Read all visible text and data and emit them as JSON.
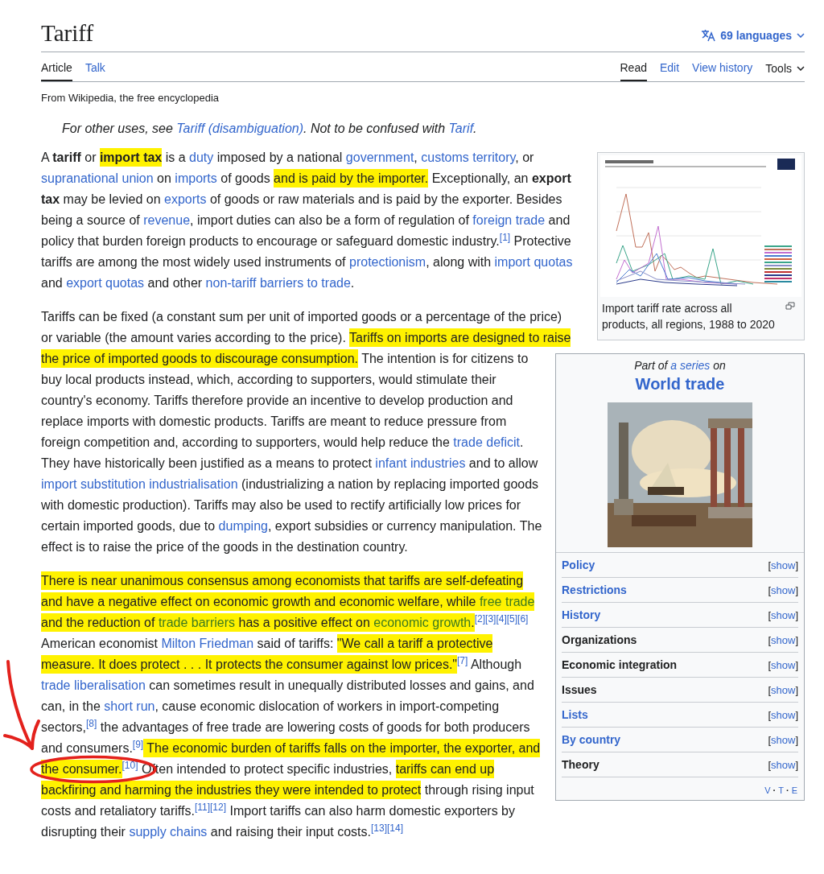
{
  "title": "Tariff",
  "languages": "69 languages",
  "tabs": [
    {
      "label": "Article",
      "selected": true
    },
    {
      "label": "Talk",
      "selected": false
    }
  ],
  "views": [
    {
      "label": "Read",
      "selected": true
    },
    {
      "label": "Edit",
      "selected": false
    },
    {
      "label": "View history",
      "selected": false
    }
  ],
  "tools": "Tools",
  "tagline": "From Wikipedia, the free encyclopedia",
  "hatnote": [
    {
      "kind": "text",
      "text": "For other uses, see "
    },
    {
      "kind": "link",
      "text": "Tariff (disambiguation)"
    },
    {
      "kind": "text",
      "text": ". Not to be confused with "
    },
    {
      "kind": "link",
      "text": "Tarif"
    },
    {
      "kind": "text",
      "text": "."
    }
  ],
  "figure": {
    "caption": "Import tariff rate across all products, all regions, 1988 to 2020"
  },
  "infobox": {
    "pretitle": [
      {
        "kind": "text",
        "text": "Part of "
      },
      {
        "kind": "link",
        "text": "a series"
      },
      {
        "kind": "text",
        "text": " on"
      }
    ],
    "title": "World trade",
    "rows": [
      {
        "label": "Policy",
        "linked": true,
        "toggle": "[show]"
      },
      {
        "label": "Restrictions",
        "linked": true,
        "toggle": "[show]"
      },
      {
        "label": "History",
        "linked": true,
        "toggle": "[show]"
      },
      {
        "label": "Organizations",
        "linked": false,
        "toggle": "[show]"
      },
      {
        "label": "Economic integration",
        "linked": false,
        "toggle": "[show]"
      },
      {
        "label": "Issues",
        "linked": false,
        "toggle": "[show]"
      },
      {
        "label": "Lists",
        "linked": true,
        "toggle": "[show]"
      },
      {
        "label": "By country",
        "linked": true,
        "toggle": "[show]"
      },
      {
        "label": "Theory",
        "linked": false,
        "toggle": "[show]"
      }
    ],
    "navbar": [
      {
        "kind": "link",
        "text": "V"
      },
      {
        "kind": "separator",
        "text": "·"
      },
      {
        "kind": "link",
        "text": "T"
      },
      {
        "kind": "separator",
        "text": "·"
      },
      {
        "kind": "link",
        "text": "E"
      }
    ]
  },
  "paragraphs": [
    [
      {
        "kind": "text",
        "text": "A ",
        "highlighted": false
      },
      {
        "kind": "bold",
        "text": "tariff",
        "highlighted": false
      },
      {
        "kind": "text",
        "text": " or ",
        "highlighted": false
      },
      {
        "kind": "bold",
        "text": "import tax",
        "highlighted": true
      },
      {
        "kind": "text",
        "text": " is a ",
        "highlighted": false
      },
      {
        "kind": "link",
        "text": "duty",
        "highlighted": false
      },
      {
        "kind": "text",
        "text": " imposed by a national ",
        "highlighted": false
      },
      {
        "kind": "link",
        "text": "government",
        "highlighted": false
      },
      {
        "kind": "text",
        "text": ", ",
        "highlighted": false
      },
      {
        "kind": "link",
        "text": "customs territory",
        "highlighted": false
      },
      {
        "kind": "text",
        "text": ", or ",
        "highlighted": false
      },
      {
        "kind": "link",
        "text": "supranational union",
        "highlighted": false
      },
      {
        "kind": "text",
        "text": " on ",
        "highlighted": false
      },
      {
        "kind": "link",
        "text": "imports",
        "highlighted": false
      },
      {
        "kind": "text",
        "text": " of goods ",
        "highlighted": false
      },
      {
        "kind": "text",
        "text": "and is paid by the importer.",
        "highlighted": true
      },
      {
        "kind": "text",
        "text": " Exceptionally, an ",
        "highlighted": false
      },
      {
        "kind": "bold",
        "text": "export tax",
        "highlighted": false
      },
      {
        "kind": "text",
        "text": " may be levied on ",
        "highlighted": false
      },
      {
        "kind": "link",
        "text": "exports",
        "highlighted": false
      },
      {
        "kind": "text",
        "text": " of goods or raw materials and is paid by the exporter. Besides being a source of ",
        "highlighted": false
      },
      {
        "kind": "link",
        "text": "revenue",
        "highlighted": false
      },
      {
        "kind": "text",
        "text": ", import duties can also be a form of regulation of ",
        "highlighted": false
      },
      {
        "kind": "link",
        "text": "foreign trade",
        "highlighted": false
      },
      {
        "kind": "text",
        "text": " and policy that burden foreign products to encourage or safeguard domestic industry.",
        "highlighted": false
      },
      {
        "kind": "ref",
        "text": "[1]",
        "highlighted": false
      },
      {
        "kind": "text",
        "text": " Protective tariffs are among the most widely used instruments of ",
        "highlighted": false
      },
      {
        "kind": "link",
        "text": "protectionism",
        "highlighted": false
      },
      {
        "kind": "text",
        "text": ", along with ",
        "highlighted": false
      },
      {
        "kind": "link",
        "text": "import quotas",
        "highlighted": false
      },
      {
        "kind": "text",
        "text": " and ",
        "highlighted": false
      },
      {
        "kind": "link",
        "text": "export quotas",
        "highlighted": false
      },
      {
        "kind": "text",
        "text": " and other ",
        "highlighted": false
      },
      {
        "kind": "link",
        "text": "non-tariff barriers to trade",
        "highlighted": false
      },
      {
        "kind": "text",
        "text": ".",
        "highlighted": false
      }
    ],
    [
      {
        "kind": "text",
        "text": "Tariffs can be fixed (a constant sum per unit of imported goods or a percentage of the price) or variable (the amount varies according to the price). ",
        "highlighted": false
      },
      {
        "kind": "text",
        "text": "Tariffs on imports are designed to raise the price of imported goods to discourage consumption.",
        "highlighted": true
      },
      {
        "kind": "text",
        "text": " The intention is for citizens to buy local products instead, which, according to supporters, would stimulate their country's economy. Tariffs therefore provide an incentive to develop production and replace imports with domestic products. Tariffs are meant to reduce pressure from foreign competition and, according to supporters, would help reduce the ",
        "highlighted": false
      },
      {
        "kind": "link",
        "text": "trade deficit",
        "highlighted": false
      },
      {
        "kind": "text",
        "text": ". They have historically been justified as a means to protect ",
        "highlighted": false
      },
      {
        "kind": "link",
        "text": "infant industries",
        "highlighted": false
      },
      {
        "kind": "text",
        "text": " and to allow ",
        "highlighted": false
      },
      {
        "kind": "link",
        "text": "import substitution industrialisation",
        "highlighted": false
      },
      {
        "kind": "text",
        "text": " (industrializing a nation by replacing imported goods with domestic production). Tariffs may also be used to rectify artificially low prices for certain imported goods, due to ",
        "highlighted": false
      },
      {
        "kind": "link",
        "text": "dumping",
        "highlighted": false
      },
      {
        "kind": "text",
        "text": ", export subsidies or currency manipulation. The effect is to raise the price of the goods in the destination country.",
        "highlighted": false
      }
    ],
    [
      {
        "kind": "text",
        "text": "There is near unanimous consensus among economists that tariffs are self-defeating and have a negative effect on economic growth and economic welfare, while ",
        "highlighted": true
      },
      {
        "kind": "link",
        "text": "free trade",
        "highlighted": true
      },
      {
        "kind": "text",
        "text": " and the reduction of ",
        "highlighted": true
      },
      {
        "kind": "link",
        "text": "trade barriers",
        "highlighted": true
      },
      {
        "kind": "text",
        "text": " has a positive effect on ",
        "highlighted": true
      },
      {
        "kind": "link",
        "text": "economic growth",
        "highlighted": true
      },
      {
        "kind": "text",
        "text": ".",
        "highlighted": true
      },
      {
        "kind": "ref",
        "text": "[2]",
        "highlighted": false
      },
      {
        "kind": "ref",
        "text": "[3]",
        "highlighted": false
      },
      {
        "kind": "ref",
        "text": "[4]",
        "highlighted": false
      },
      {
        "kind": "ref",
        "text": "[5]",
        "highlighted": false
      },
      {
        "kind": "ref",
        "text": "[6]",
        "highlighted": false
      },
      {
        "kind": "text",
        "text": " American economist ",
        "highlighted": false
      },
      {
        "kind": "link",
        "text": "Milton Friedman",
        "highlighted": false
      },
      {
        "kind": "text",
        "text": " said of tariffs: ",
        "highlighted": false
      },
      {
        "kind": "text",
        "text": "\"We call a tariff a protective measure. It does protect . . . It protects the consumer against low prices.\"",
        "highlighted": true
      },
      {
        "kind": "ref",
        "text": "[7]",
        "highlighted": false
      },
      {
        "kind": "text",
        "text": " Although ",
        "highlighted": false
      },
      {
        "kind": "link",
        "text": "trade liberalisation",
        "highlighted": false
      },
      {
        "kind": "text",
        "text": " can sometimes result in unequally distributed losses and gains, and can, in the ",
        "highlighted": false
      },
      {
        "kind": "link",
        "text": "short run",
        "highlighted": false
      },
      {
        "kind": "text",
        "text": ", cause economic dislocation of workers in import-competing sectors,",
        "highlighted": false
      },
      {
        "kind": "ref",
        "text": "[8]",
        "highlighted": false
      },
      {
        "kind": "text",
        "text": " the advantages of free trade are lowering costs of goods for both producers and consumers.",
        "highlighted": false
      },
      {
        "kind": "ref",
        "text": "[9]",
        "highlighted": false
      },
      {
        "kind": "text",
        "text": " The economic burden of tariffs falls on the importer, the exporter, and the consumer.",
        "highlighted": true
      },
      {
        "kind": "ref",
        "text": "[10]",
        "highlighted": false
      },
      {
        "kind": "text",
        "text": " Often intended to protect specific industries, ",
        "highlighted": false
      },
      {
        "kind": "text",
        "text": "tariffs can end up backfiring and harming the industries they were intended to protect",
        "highlighted": true
      },
      {
        "kind": "text",
        "text": " through rising input costs and retaliatory tariffs.",
        "highlighted": false
      },
      {
        "kind": "ref",
        "text": "[11]",
        "highlighted": false
      },
      {
        "kind": "ref",
        "text": "[12]",
        "highlighted": false
      },
      {
        "kind": "text",
        "text": " Import tariffs can also harm domestic exporters by disrupting their ",
        "highlighted": false
      },
      {
        "kind": "link",
        "text": "supply chains",
        "highlighted": false
      },
      {
        "kind": "text",
        "text": " and raising their input costs.",
        "highlighted": false
      },
      {
        "kind": "ref",
        "text": "[13]",
        "highlighted": false
      },
      {
        "kind": "ref",
        "text": "[14]",
        "highlighted": false
      }
    ]
  ],
  "annotations": [
    {
      "kind": "arrow"
    },
    {
      "kind": "ellipse"
    }
  ]
}
